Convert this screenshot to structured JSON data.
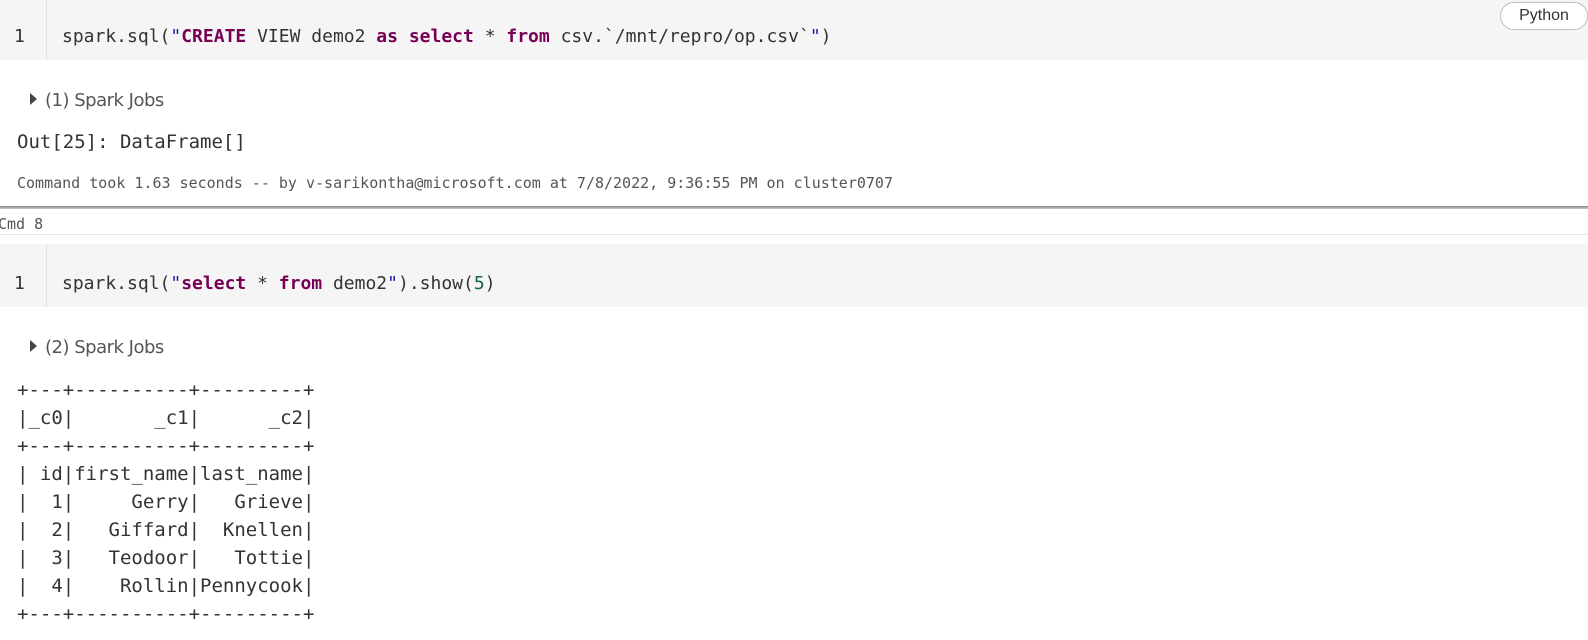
{
  "cell7": {
    "language_badge": "Python",
    "line_number": "1",
    "code_tokens": [
      {
        "t": "spark.sql(",
        "c": "plain"
      },
      {
        "t": "\"",
        "c": "str"
      },
      {
        "t": "CREATE",
        "c": "kw"
      },
      {
        "t": " VIEW demo2 ",
        "c": "plain"
      },
      {
        "t": "as",
        "c": "kw"
      },
      {
        "t": " ",
        "c": "plain"
      },
      {
        "t": "select",
        "c": "kw"
      },
      {
        "t": " * ",
        "c": "plain"
      },
      {
        "t": "from",
        "c": "kw"
      },
      {
        "t": " csv.`/mnt/repro/op.csv`",
        "c": "plain"
      },
      {
        "t": "\"",
        "c": "str"
      },
      {
        "t": ")",
        "c": "plain"
      }
    ],
    "spark_jobs": "(1) Spark Jobs",
    "output": "Out[25]: DataFrame[]",
    "command_took": "Command took 1.63 seconds -- by v-sarikontha@microsoft.com at 7/8/2022, 9:36:55 PM on cluster0707"
  },
  "cell8": {
    "cmd_label": "Cmd 8",
    "line_number": "1",
    "code_tokens": [
      {
        "t": "spark.sql(",
        "c": "plain"
      },
      {
        "t": "\"",
        "c": "str"
      },
      {
        "t": "select",
        "c": "kw"
      },
      {
        "t": " * ",
        "c": "plain"
      },
      {
        "t": "from",
        "c": "kw"
      },
      {
        "t": " demo2",
        "c": "plain"
      },
      {
        "t": "\"",
        "c": "str"
      },
      {
        "t": ").show(",
        "c": "plain"
      },
      {
        "t": "5",
        "c": "num"
      },
      {
        "t": ")",
        "c": "plain"
      }
    ],
    "spark_jobs": "(2) Spark Jobs",
    "table": {
      "border": "+---+----------+---------+",
      "header": "|_c0|       _c1|      _c2|",
      "rows": [
        "| id|first_name|last_name|",
        "|  1|     Gerry|   Grieve|",
        "|  2|   Giffard|  Knellen|",
        "|  3|   Teodoor|   Tottie|",
        "|  4|    Rollin|Pennycook|"
      ],
      "values": [
        {
          "id": "id",
          "first_name": "first_name",
          "last_name": "last_name"
        },
        {
          "id": "1",
          "first_name": "Gerry",
          "last_name": "Grieve"
        },
        {
          "id": "2",
          "first_name": "Giffard",
          "last_name": "Knellen"
        },
        {
          "id": "3",
          "first_name": "Teodoor",
          "last_name": "Tottie"
        },
        {
          "id": "4",
          "first_name": "Rollin",
          "last_name": "Pennycook"
        }
      ]
    }
  }
}
